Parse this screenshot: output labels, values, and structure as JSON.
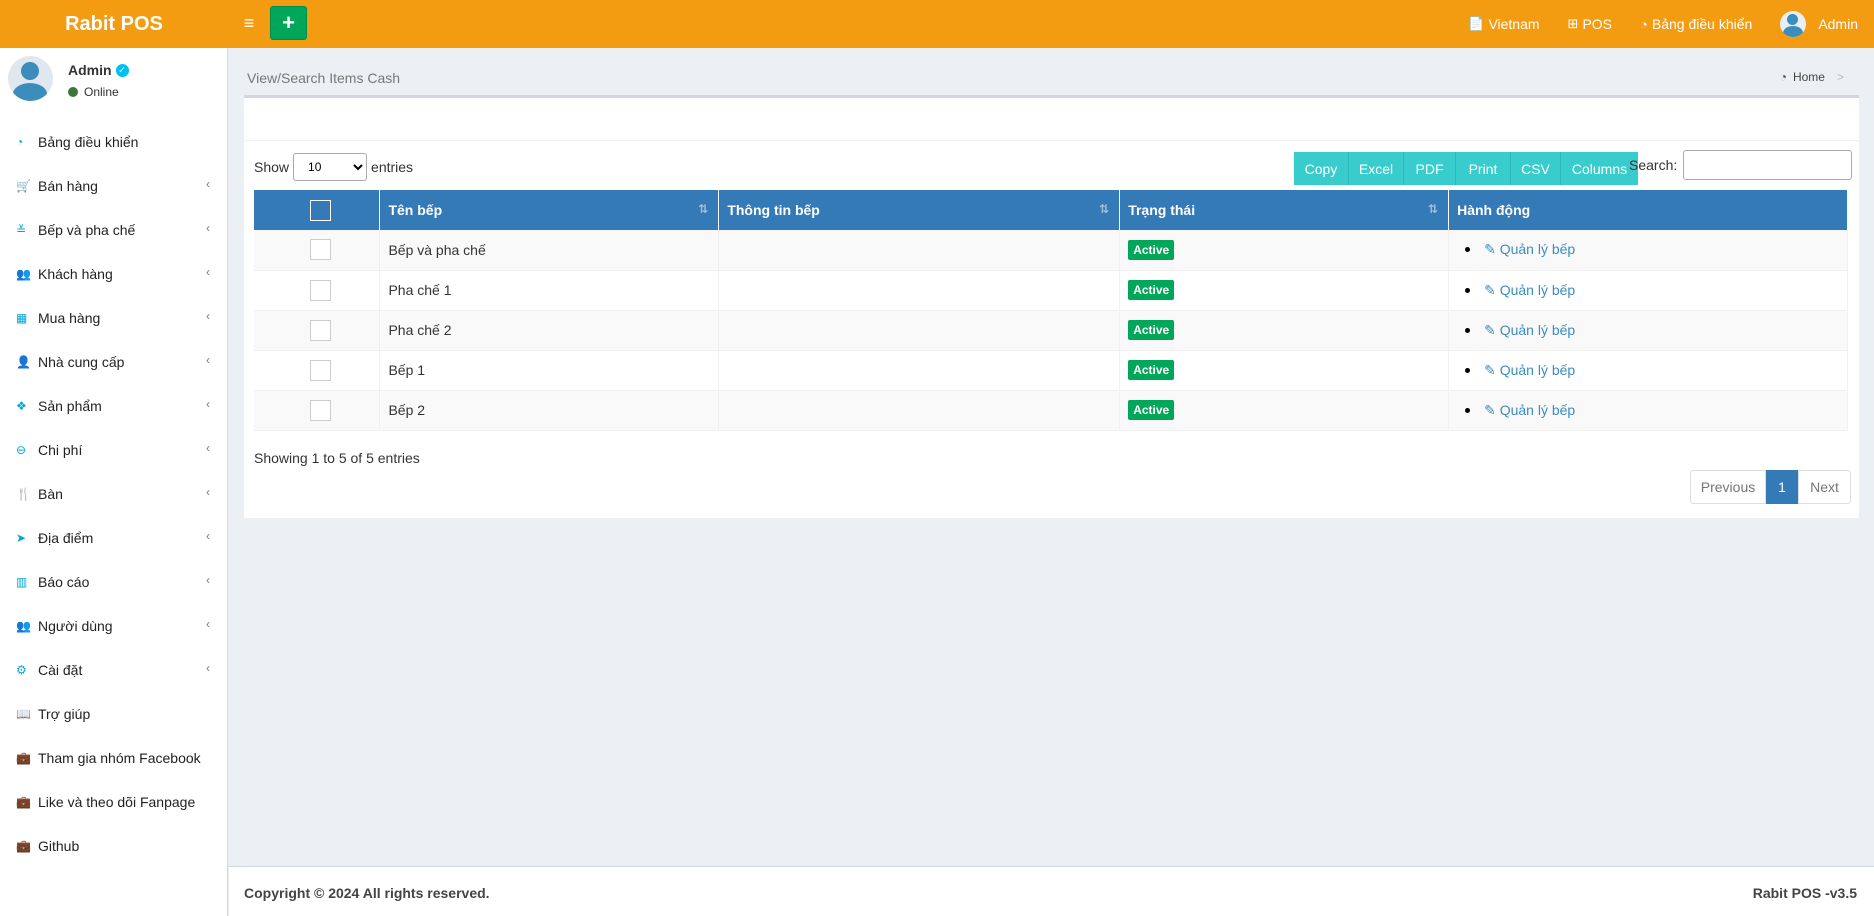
{
  "header": {
    "logo": "Rabit POS",
    "hamburger": "≡",
    "add": "+",
    "nav": [
      {
        "icon": "📄",
        "label": "Vietnam"
      },
      {
        "icon": "⊞",
        "label": "POS"
      },
      {
        "icon": "◔",
        "label": "Bảng điều khiển"
      },
      {
        "label": "Admin"
      }
    ]
  },
  "sidebar": {
    "user": {
      "name": "Admin",
      "status": "Online"
    },
    "items": [
      {
        "icon": "◔",
        "label": "Bảng điều khiển"
      },
      {
        "icon": "🛒",
        "label": "Bán hàng"
      },
      {
        "icon": "≚",
        "label": "Bếp và pha chế"
      },
      {
        "icon": "👥",
        "label": "Khách hàng"
      },
      {
        "icon": "▦",
        "label": "Mua hàng"
      },
      {
        "icon": "👤",
        "label": "Nhà cung cấp"
      },
      {
        "icon": "❖",
        "label": "Sản phẩm"
      },
      {
        "icon": "⊖",
        "label": "Chi phí"
      },
      {
        "icon": "🍴",
        "label": "Bàn"
      },
      {
        "icon": "➤",
        "label": "Địa điểm"
      },
      {
        "icon": "▥",
        "label": "Báo cáo"
      },
      {
        "icon": "👥",
        "label": "Người dùng"
      },
      {
        "icon": "⚙",
        "label": "Cài đặt"
      },
      {
        "icon": "📖",
        "label": "Trợ giúp"
      },
      {
        "icon": "💼",
        "label": "Tham gia nhóm Facebook"
      },
      {
        "icon": "💼",
        "label": "Like và theo dõi Fanpage"
      },
      {
        "icon": "💼",
        "label": "Github"
      }
    ],
    "chevron": "‹"
  },
  "page": {
    "title": "View/Search Items Cash",
    "breadcrumb": {
      "icon": "◔",
      "home": "Home",
      "sep": ">"
    }
  },
  "datatable": {
    "show_label": "Show",
    "entries_label": "entries",
    "page_length": "10",
    "buttons": [
      "Copy",
      "Excel",
      "PDF",
      "Print",
      "CSV",
      "Columns"
    ],
    "search_label": "Search:",
    "search_value": "",
    "columns": [
      "Tên bếp",
      "Thông tin bếp",
      "Trạng thái",
      "Hành động"
    ],
    "sort_icon": "⇅",
    "rows": [
      {
        "name": "Bếp và pha chế",
        "info": "",
        "status": "Active",
        "action": "Quản lý bếp"
      },
      {
        "name": "Pha chế 1",
        "info": "",
        "status": "Active",
        "action": "Quản lý bếp"
      },
      {
        "name": "Pha chế 2",
        "info": "",
        "status": "Active",
        "action": "Quản lý bếp"
      },
      {
        "name": "Bếp 1",
        "info": "",
        "status": "Active",
        "action": "Quản lý bếp"
      },
      {
        "name": "Bếp 2",
        "info": "",
        "status": "Active",
        "action": "Quản lý bếp"
      }
    ],
    "info": "Showing 1 to 5 of 5 entries",
    "pagination": {
      "previous": "Previous",
      "current": "1",
      "next": "Next"
    }
  },
  "footer": {
    "copyright": "Copyright © 2024 All rights reserved.",
    "version": "Rabit POS -v3.5"
  },
  "colors": {
    "header": "#f39c12",
    "table_header": "#337ab7",
    "status_active": "#00a65a",
    "dt_buttons": "#39cccc",
    "link": "#3c8dbc"
  }
}
